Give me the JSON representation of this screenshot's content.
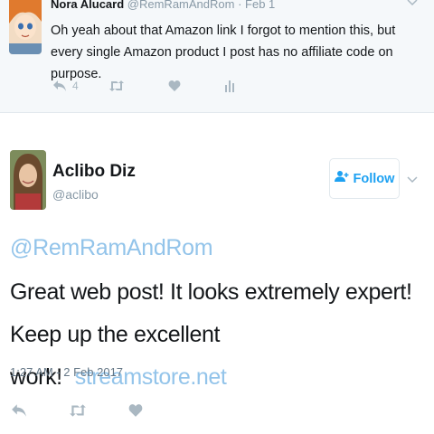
{
  "parent_tweet": {
    "name": "Nora Alucard",
    "handle": "@RemRamAndRom",
    "date": "· Feb 1",
    "text": "Oh yeah about that Amazon link I forgot to mention this, but every single Amazon product I post has no affiliate code on purpose.",
    "reply_count": "4"
  },
  "main_tweet": {
    "name": "Aclibo Diz",
    "handle": "@aclibo",
    "follow_label": "Follow",
    "mention": "@RemRamAndRom",
    "text": "Great web post! It looks extremely expert! Keep up the excellent work!",
    "link": "streamstore.net",
    "timestamp": "1:27 AM - 2 Feb 2017"
  },
  "icons": {
    "reply": "reply-icon",
    "retweet": "retweet-icon",
    "like": "heart-icon",
    "analytics": "analytics-icon",
    "more": "chevron-down-icon",
    "follow": "add-user-icon"
  },
  "colors": {
    "accent": "#1da1f2",
    "link": "#93c4ea",
    "muted": "#aab8c2",
    "parent_bg": "#f5f8fa"
  }
}
